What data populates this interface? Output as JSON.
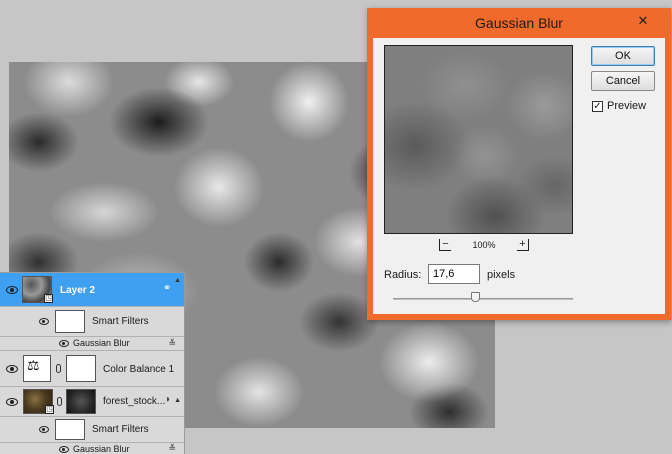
{
  "dialog": {
    "title": "Gaussian Blur",
    "ok_label": "OK",
    "cancel_label": "Cancel",
    "preview_label": "Preview",
    "preview_checked": "✓",
    "zoom_minus": "−",
    "zoom_plus": "+",
    "zoom_percent": "100%",
    "radius_label": "Radius:",
    "radius_value": "17,6",
    "radius_unit": "pixels",
    "slider_fraction": 0.46,
    "close_glyph": "✕",
    "accent_color": "#f06b2b"
  },
  "layers": [
    {
      "name": "Layer 2",
      "selected": true
    },
    {
      "name": "Smart Filters"
    },
    {
      "name": "Gaussian Blur"
    },
    {
      "name": "Color Balance 1"
    },
    {
      "name": "forest_stock..."
    },
    {
      "name": "Smart Filters"
    },
    {
      "name": "Gaussian Blur"
    }
  ],
  "icons": {
    "eye": "eye-icon",
    "smart_object": "smart-object-icon",
    "filter_options": "filter-options-icon",
    "scales": "color-balance-icon"
  }
}
